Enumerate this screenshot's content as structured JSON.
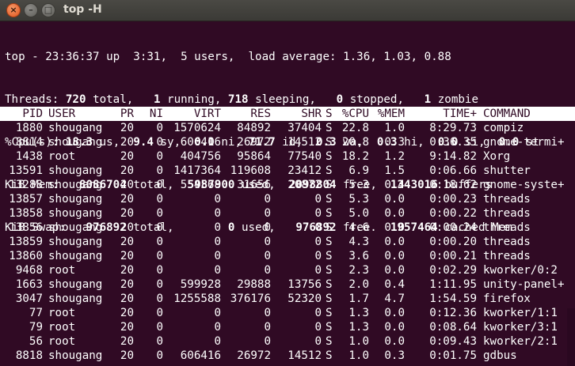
{
  "window": {
    "title": "top -H",
    "close_glyph": "×",
    "min_glyph": "–",
    "max_glyph": "□"
  },
  "summary": {
    "line1": "top - 23:36:37 up  3:31,  5 users,  load average: 1.36, 1.03, 0.88",
    "threads": {
      "label": "Threads:",
      "total": "720",
      "total_l": "total,",
      "running": "1",
      "running_l": "running,",
      "sleeping": "718",
      "sleeping_l": "sleeping,",
      "stopped": "0",
      "stopped_l": "stopped,",
      "zombie": "1",
      "zombie_l": "zombie"
    },
    "cpu": {
      "label": "%Cpu(s):",
      "us": "18.3",
      "us_l": "us,",
      "sy": "9.4",
      "sy_l": "sy,",
      "ni": "0.0",
      "ni_l": "ni,",
      "id": "71.7",
      "id_l": "id,",
      "wa": "0.3",
      "wa_l": "wa,",
      "hi": "0.3",
      "hi_l": "hi,",
      "si": "0.0",
      "si_l": "si,",
      "st": "0.0",
      "st_l": "st"
    },
    "mem": {
      "label": "KiB Mem:",
      "total": "8086704",
      "total_l": "total,",
      "used": "5987900",
      "used_l": "used,",
      "free": "2098804",
      "free_l": "free,",
      "buffers": "1343016",
      "buffers_l": "buffers"
    },
    "swap": {
      "label": "KiB Swap:",
      "total": "976892",
      "total_l": "total,",
      "used": "0",
      "used_l": "used,",
      "free": "976892",
      "free_l": "free.",
      "cached": "1957464",
      "cached_l": "cached Mem"
    }
  },
  "table": {
    "headers": {
      "pid": "PID",
      "user": "USER",
      "pr": "PR",
      "ni": "NI",
      "virt": "VIRT",
      "res": "RES",
      "shr": "SHR",
      "s": "S",
      "cpu": "%CPU",
      "mem": "%MEM",
      "time": "TIME+",
      "command": "COMMAND"
    },
    "rows": [
      {
        "pid": "1880",
        "user": "shougang",
        "pr": "20",
        "ni": "0",
        "virt": "1570624",
        "res": "84892",
        "shr": "37404",
        "s": "S",
        "cpu": "22.8",
        "mem": "1.0",
        "time": "8:29.73",
        "command": "compiz"
      },
      {
        "pid": "8814",
        "user": "shougang",
        "pr": "20",
        "ni": "0",
        "virt": "606416",
        "res": "26972",
        "shr": "14512",
        "s": "S",
        "cpu": "20.8",
        "mem": "0.3",
        "time": "0:36.35",
        "command": "gnome-termi+"
      },
      {
        "pid": "1438",
        "user": "root",
        "pr": "20",
        "ni": "0",
        "virt": "404756",
        "res": "95864",
        "shr": "77540",
        "s": "S",
        "cpu": "18.2",
        "mem": "1.2",
        "time": "9:14.82",
        "command": "Xorg"
      },
      {
        "pid": "13591",
        "user": "shougang",
        "pr": "20",
        "ni": "0",
        "virt": "1417364",
        "res": "119608",
        "shr": "23412",
        "s": "S",
        "cpu": "6.9",
        "mem": "1.5",
        "time": "0:06.66",
        "command": "shutter"
      },
      {
        "pid": "13288",
        "user": "shougang",
        "pr": "20",
        "ni": "0",
        "virt": "554568",
        "res": "31656",
        "shr": "20872",
        "s": "S",
        "cpu": "5.3",
        "mem": "0.4",
        "time": "0:18.62",
        "command": "gnome-syste+"
      },
      {
        "pid": "13857",
        "user": "shougang",
        "pr": "20",
        "ni": "0",
        "virt": "0",
        "res": "0",
        "shr": "0",
        "s": "S",
        "cpu": "5.3",
        "mem": "0.0",
        "time": "0:00.23",
        "command": "threads"
      },
      {
        "pid": "13858",
        "user": "shougang",
        "pr": "20",
        "ni": "0",
        "virt": "0",
        "res": "0",
        "shr": "0",
        "s": "S",
        "cpu": "5.0",
        "mem": "0.0",
        "time": "0:00.22",
        "command": "threads"
      },
      {
        "pid": "13856",
        "user": "shougang",
        "pr": "20",
        "ni": "0",
        "virt": "0",
        "res": "0",
        "shr": "0",
        "s": "S",
        "cpu": "4.6",
        "mem": "0.0",
        "time": "0:00.24",
        "command": "threads"
      },
      {
        "pid": "13859",
        "user": "shougang",
        "pr": "20",
        "ni": "0",
        "virt": "0",
        "res": "0",
        "shr": "0",
        "s": "S",
        "cpu": "4.3",
        "mem": "0.0",
        "time": "0:00.20",
        "command": "threads"
      },
      {
        "pid": "13860",
        "user": "shougang",
        "pr": "20",
        "ni": "0",
        "virt": "0",
        "res": "0",
        "shr": "0",
        "s": "S",
        "cpu": "3.6",
        "mem": "0.0",
        "time": "0:00.21",
        "command": "threads"
      },
      {
        "pid": "9468",
        "user": "root",
        "pr": "20",
        "ni": "0",
        "virt": "0",
        "res": "0",
        "shr": "0",
        "s": "S",
        "cpu": "2.3",
        "mem": "0.0",
        "time": "0:02.29",
        "command": "kworker/0:2"
      },
      {
        "pid": "1663",
        "user": "shougang",
        "pr": "20",
        "ni": "0",
        "virt": "599928",
        "res": "29888",
        "shr": "13756",
        "s": "S",
        "cpu": "2.0",
        "mem": "0.4",
        "time": "1:11.95",
        "command": "unity-panel+"
      },
      {
        "pid": "3047",
        "user": "shougang",
        "pr": "20",
        "ni": "0",
        "virt": "1255588",
        "res": "376176",
        "shr": "52320",
        "s": "S",
        "cpu": "1.7",
        "mem": "4.7",
        "time": "1:54.59",
        "command": "firefox"
      },
      {
        "pid": "77",
        "user": "root",
        "pr": "20",
        "ni": "0",
        "virt": "0",
        "res": "0",
        "shr": "0",
        "s": "S",
        "cpu": "1.3",
        "mem": "0.0",
        "time": "0:12.36",
        "command": "kworker/1:1"
      },
      {
        "pid": "79",
        "user": "root",
        "pr": "20",
        "ni": "0",
        "virt": "0",
        "res": "0",
        "shr": "0",
        "s": "S",
        "cpu": "1.3",
        "mem": "0.0",
        "time": "0:08.64",
        "command": "kworker/3:1"
      },
      {
        "pid": "56",
        "user": "root",
        "pr": "20",
        "ni": "0",
        "virt": "0",
        "res": "0",
        "shr": "0",
        "s": "S",
        "cpu": "1.0",
        "mem": "0.0",
        "time": "0:09.43",
        "command": "kworker/2:1"
      },
      {
        "pid": "8818",
        "user": "shougang",
        "pr": "20",
        "ni": "0",
        "virt": "606416",
        "res": "26972",
        "shr": "14512",
        "s": "S",
        "cpu": "1.0",
        "mem": "0.3",
        "time": "0:01.75",
        "command": "gdbus"
      }
    ]
  },
  "colors": {
    "terminal_bg": "#300a24",
    "terminal_fg": "#ffffff",
    "titlebar_bg": "#3c3b37",
    "close_button": "#e2541c",
    "header_row_bg": "#ffffff"
  }
}
